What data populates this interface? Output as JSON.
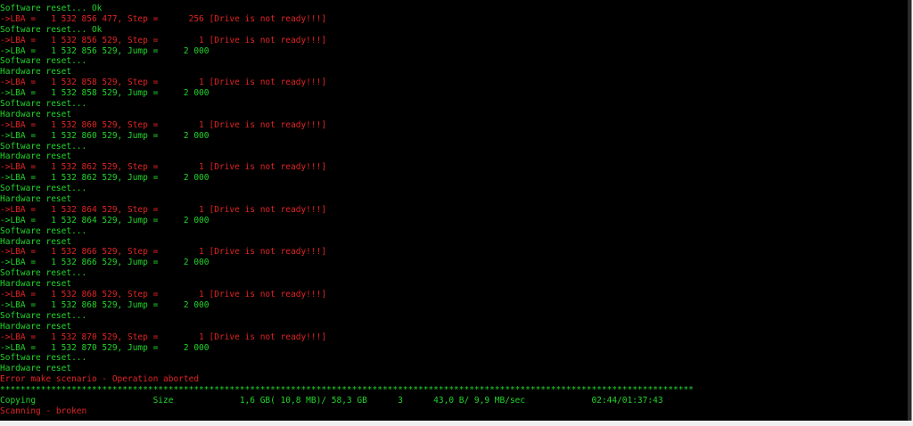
{
  "colors": {
    "background": "#000000",
    "green": "#22d52a",
    "red": "#e02424"
  },
  "console": {
    "lines": [
      {
        "text": "Software reset... Ok",
        "color": "green"
      },
      {
        "text": "->LBA =   1 532 856 477, Step =      256 [Drive is not ready!!!]",
        "color": "red"
      },
      {
        "text": "Software reset... Ok",
        "color": "green"
      },
      {
        "text": "->LBA =   1 532 856 529, Step =        1 [Drive is not ready!!!]",
        "color": "red"
      },
      {
        "text": "->LBA =   1 532 856 529, Jump =     2 000",
        "color": "green"
      },
      {
        "text": "Software reset...",
        "color": "green"
      },
      {
        "text": "Hardware reset",
        "color": "green"
      },
      {
        "text": "->LBA =   1 532 858 529, Step =        1 [Drive is not ready!!!]",
        "color": "red"
      },
      {
        "text": "->LBA =   1 532 858 529, Jump =     2 000",
        "color": "green"
      },
      {
        "text": "Software reset...",
        "color": "green"
      },
      {
        "text": "Hardware reset",
        "color": "green"
      },
      {
        "text": "->LBA =   1 532 860 529, Step =        1 [Drive is not ready!!!]",
        "color": "red"
      },
      {
        "text": "->LBA =   1 532 860 529, Jump =     2 000",
        "color": "green"
      },
      {
        "text": "Software reset...",
        "color": "green"
      },
      {
        "text": "Hardware reset",
        "color": "green"
      },
      {
        "text": "->LBA =   1 532 862 529, Step =        1 [Drive is not ready!!!]",
        "color": "red"
      },
      {
        "text": "->LBA =   1 532 862 529, Jump =     2 000",
        "color": "green"
      },
      {
        "text": "Software reset...",
        "color": "green"
      },
      {
        "text": "Hardware reset",
        "color": "green"
      },
      {
        "text": "->LBA =   1 532 864 529, Step =        1 [Drive is not ready!!!]",
        "color": "red"
      },
      {
        "text": "->LBA =   1 532 864 529, Jump =     2 000",
        "color": "green"
      },
      {
        "text": "Software reset...",
        "color": "green"
      },
      {
        "text": "Hardware reset",
        "color": "green"
      },
      {
        "text": "->LBA =   1 532 866 529, Step =        1 [Drive is not ready!!!]",
        "color": "red"
      },
      {
        "text": "->LBA =   1 532 866 529, Jump =     2 000",
        "color": "green"
      },
      {
        "text": "Software reset...",
        "color": "green"
      },
      {
        "text": "Hardware reset",
        "color": "green"
      },
      {
        "text": "->LBA =   1 532 868 529, Step =        1 [Drive is not ready!!!]",
        "color": "red"
      },
      {
        "text": "->LBA =   1 532 868 529, Jump =     2 000",
        "color": "green"
      },
      {
        "text": "Software reset...",
        "color": "green"
      },
      {
        "text": "Hardware reset",
        "color": "green"
      },
      {
        "text": "->LBA =   1 532 870 529, Step =        1 [Drive is not ready!!!]",
        "color": "red"
      },
      {
        "text": "->LBA =   1 532 870 529, Jump =     2 000",
        "color": "green"
      },
      {
        "text": "Software reset...",
        "color": "green"
      },
      {
        "text": "Hardware reset",
        "color": "green"
      },
      {
        "text": "Error make scenario - Operation aborted",
        "color": "red"
      },
      {
        "text": "****************************************************************************************************************************************",
        "color": "green"
      },
      {
        "text": "Copying                       Size             1,6 GB( 10,8 MB)/ 58,3 GB      3      43,0 B/ 9,9 MB/sec             02:44/01:37:43",
        "color": "green"
      },
      {
        "text": "Scanning - broken",
        "color": "red"
      }
    ]
  }
}
